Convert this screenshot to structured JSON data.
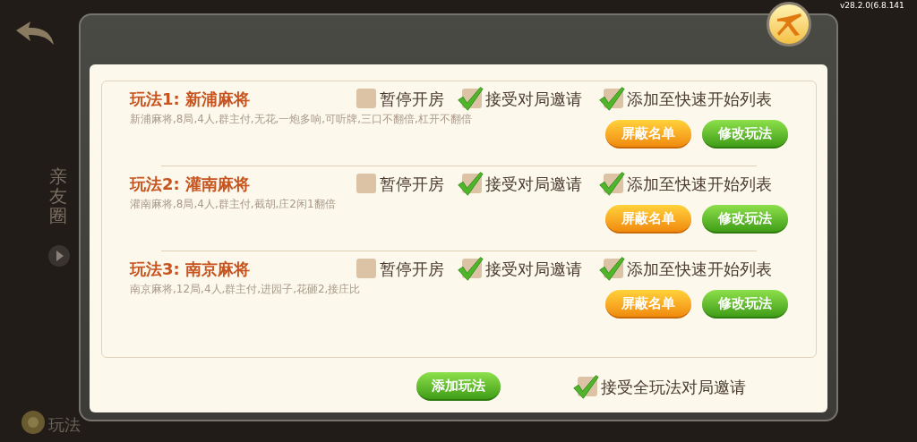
{
  "background": {
    "version": "v28.2.0(6.8.141",
    "side_tab": "亲友圈",
    "help_label": "玩法"
  },
  "dialog": {
    "rules": [
      {
        "title": "玩法1: 新浦麻将",
        "description": "新浦麻将,8局,4人,群主付,无花,一炮多响,可听牌,三口不翻倍,杠开不翻倍",
        "options": [
          {
            "label": "暂停开房",
            "checked": false
          },
          {
            "label": "接受对局邀请",
            "checked": true
          },
          {
            "label": "添加至快速开始列表",
            "checked": true
          }
        ],
        "buttons": [
          {
            "label": "屏蔽名单",
            "kind": "orange"
          },
          {
            "label": "修改玩法",
            "kind": "green"
          }
        ]
      },
      {
        "title": "玩法2: 灌南麻将",
        "description": "灌南麻将,8局,4人,群主付,截胡,庄2闲1翻倍",
        "options": [
          {
            "label": "暂停开房",
            "checked": false
          },
          {
            "label": "接受对局邀请",
            "checked": true
          },
          {
            "label": "添加至快速开始列表",
            "checked": true
          }
        ],
        "buttons": [
          {
            "label": "屏蔽名单",
            "kind": "orange"
          },
          {
            "label": "修改玩法",
            "kind": "green"
          }
        ]
      },
      {
        "title": "玩法3: 南京麻将",
        "description": "南京麻将,12局,4人,群主付,进园子,花砸2,接庄比",
        "options": [
          {
            "label": "暂停开房",
            "checked": false
          },
          {
            "label": "接受对局邀请",
            "checked": true
          },
          {
            "label": "添加至快速开始列表",
            "checked": true
          }
        ],
        "buttons": [
          {
            "label": "屏蔽名单",
            "kind": "orange"
          },
          {
            "label": "修改玩法",
            "kind": "green"
          }
        ]
      }
    ],
    "add_button": "添加玩法",
    "accept_all": {
      "label": "接受全玩法对局邀请",
      "checked": true
    }
  }
}
